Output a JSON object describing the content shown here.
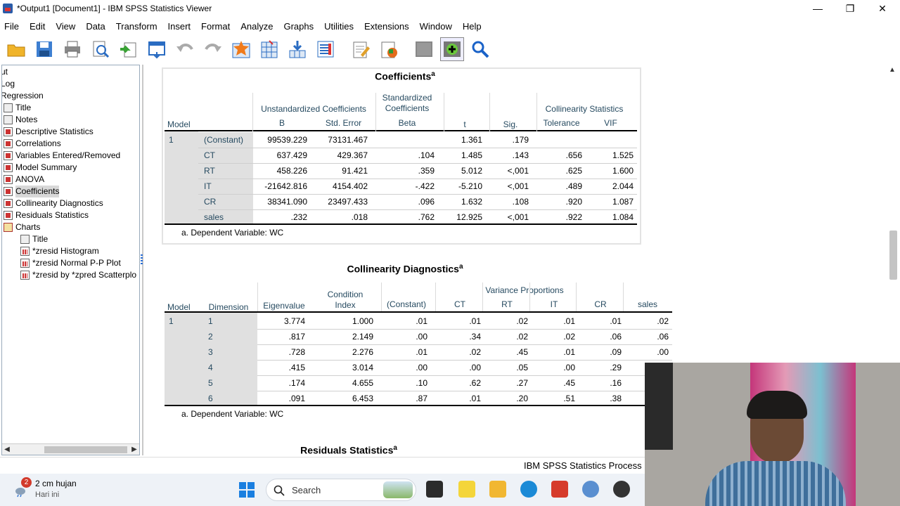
{
  "window": {
    "title": "*Output1 [Document1] - IBM SPSS Statistics Viewer"
  },
  "menu": [
    "File",
    "Edit",
    "View",
    "Data",
    "Transform",
    "Insert",
    "Format",
    "Analyze",
    "Graphs",
    "Utilities",
    "Extensions",
    "Window",
    "Help"
  ],
  "toolbar": [
    "open-icon",
    "save-icon",
    "print-icon",
    "print-preview-icon",
    "export-icon",
    "recall-dialog-icon",
    "undo-icon",
    "redo-icon",
    "goto-data-icon",
    "goto-case-icon",
    "goto-variable-icon",
    "variables-icon",
    "edit-output-icon",
    "insert-output-icon",
    "pivot-icon",
    "designate-window-icon",
    "find-icon"
  ],
  "outline": {
    "items": [
      {
        "label": "ut",
        "icon": "",
        "indent": 0
      },
      {
        "label": "Log",
        "icon": "",
        "indent": 0
      },
      {
        "label": "Regression",
        "icon": "",
        "indent": 0
      },
      {
        "label": "Title",
        "icon": "note",
        "indent": 1
      },
      {
        "label": "Notes",
        "icon": "note",
        "indent": 1
      },
      {
        "label": "Descriptive Statistics",
        "icon": "table",
        "indent": 1
      },
      {
        "label": "Correlations",
        "icon": "table",
        "indent": 1
      },
      {
        "label": "Variables Entered/Removed",
        "icon": "table",
        "indent": 1
      },
      {
        "label": "Model Summary",
        "icon": "table",
        "indent": 1
      },
      {
        "label": "ANOVA",
        "icon": "table",
        "indent": 1
      },
      {
        "label": "Coefficients",
        "icon": "table",
        "indent": 1,
        "selected": true
      },
      {
        "label": "Collinearity Diagnostics",
        "icon": "table",
        "indent": 1
      },
      {
        "label": "Residuals Statistics",
        "icon": "table",
        "indent": 1
      },
      {
        "label": "Charts",
        "icon": "book",
        "indent": 1
      },
      {
        "label": "Title",
        "icon": "note",
        "indent": 2
      },
      {
        "label": "*zresid Histogram",
        "icon": "chart",
        "indent": 2
      },
      {
        "label": "*zresid Normal P-P Plot",
        "icon": "chart",
        "indent": 2
      },
      {
        "label": "*zresid by *zpred Scatterplo",
        "icon": "chart",
        "indent": 2
      }
    ]
  },
  "coefficients": {
    "title": "Coefficients",
    "sup": "a",
    "headers": {
      "model": "Model",
      "unstd": "Unstandardized Coefficients",
      "b": "B",
      "se": "Std. Error",
      "std": "Standardized Coefficients",
      "beta": "Beta",
      "t": "t",
      "sig": "Sig.",
      "collin": "Collinearity Statistics",
      "tol": "Tolerance",
      "vif": "VIF"
    },
    "model_num": "1",
    "rows": [
      {
        "name": "(Constant)",
        "b": "99539.229",
        "se": "73131.467",
        "beta": "",
        "t": "1.361",
        "sig": ".179",
        "tol": "",
        "vif": ""
      },
      {
        "name": "CT",
        "b": "637.429",
        "se": "429.367",
        "beta": ".104",
        "t": "1.485",
        "sig": ".143",
        "tol": ".656",
        "vif": "1.525"
      },
      {
        "name": "RT",
        "b": "458.226",
        "se": "91.421",
        "beta": ".359",
        "t": "5.012",
        "sig": "<,001",
        "tol": ".625",
        "vif": "1.600"
      },
      {
        "name": "IT",
        "b": "-21642.816",
        "se": "4154.402",
        "beta": "-.422",
        "t": "-5.210",
        "sig": "<,001",
        "tol": ".489",
        "vif": "2.044"
      },
      {
        "name": "CR",
        "b": "38341.090",
        "se": "23497.433",
        "beta": ".096",
        "t": "1.632",
        "sig": ".108",
        "tol": ".920",
        "vif": "1.087"
      },
      {
        "name": "sales",
        "b": ".232",
        "se": ".018",
        "beta": ".762",
        "t": "12.925",
        "sig": "<,001",
        "tol": ".922",
        "vif": "1.084"
      }
    ],
    "footnote": "a. Dependent Variable: WC"
  },
  "collinearity": {
    "title": "Collinearity Diagnostics",
    "sup": "a",
    "headers": {
      "model": "Model",
      "dimension": "Dimension",
      "eigen": "Eigenvalue",
      "cond": "Condition Index",
      "varprop": "Variance Proportions",
      "cols": [
        "(Constant)",
        "CT",
        "RT",
        "IT",
        "CR",
        "sales"
      ]
    },
    "model_num": "1",
    "rows": [
      {
        "dim": "1",
        "eigen": "3.774",
        "cond": "1.000",
        "props": [
          ".01",
          ".01",
          ".02",
          ".01",
          ".01",
          ".02"
        ]
      },
      {
        "dim": "2",
        "eigen": ".817",
        "cond": "2.149",
        "props": [
          ".00",
          ".34",
          ".02",
          ".02",
          ".06",
          ".06"
        ]
      },
      {
        "dim": "3",
        "eigen": ".728",
        "cond": "2.276",
        "props": [
          ".01",
          ".02",
          ".45",
          ".01",
          ".09",
          ".00"
        ]
      },
      {
        "dim": "4",
        "eigen": ".415",
        "cond": "3.014",
        "props": [
          ".00",
          ".00",
          ".05",
          ".00",
          ".29",
          ""
        ]
      },
      {
        "dim": "5",
        "eigen": ".174",
        "cond": "4.655",
        "props": [
          ".10",
          ".62",
          ".27",
          ".45",
          ".16",
          ""
        ]
      },
      {
        "dim": "6",
        "eigen": ".091",
        "cond": "6.453",
        "props": [
          ".87",
          ".01",
          ".20",
          ".51",
          ".38",
          ""
        ]
      }
    ],
    "footnote": "a. Dependent Variable: WC"
  },
  "residuals": {
    "title": "Residuals Statistics",
    "sup": "a"
  },
  "status": {
    "text": "IBM SPSS Statistics Process"
  },
  "taskbar": {
    "weather_badge": "2",
    "weather_line1": "2 cm hujan",
    "weather_line2": "Hari ini",
    "search_label": "Search"
  }
}
